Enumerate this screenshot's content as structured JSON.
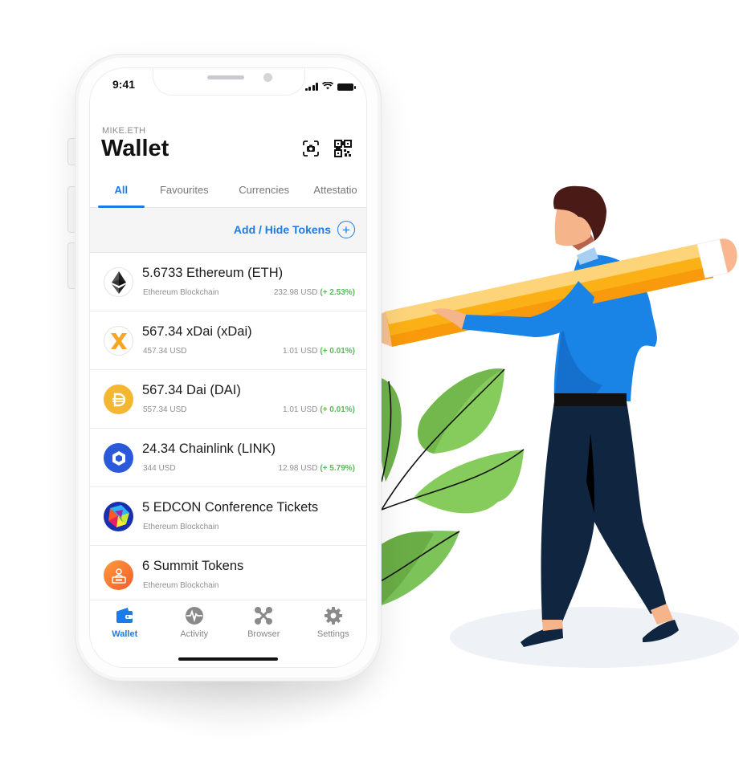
{
  "status_bar": {
    "time": "9:41"
  },
  "header": {
    "account": "MIKE.ETH",
    "title": "Wallet",
    "icons": [
      "camera-scan-icon",
      "qr-code-icon"
    ]
  },
  "tabs": [
    {
      "label": "All",
      "active": true
    },
    {
      "label": "Favourites",
      "active": false
    },
    {
      "label": "Currencies",
      "active": false
    },
    {
      "label": "Attestatio",
      "active": false
    }
  ],
  "add_hide_tokens": {
    "label": "Add / Hide Tokens",
    "icon": "plus-circle-icon"
  },
  "tokens": [
    {
      "name": "5.6733 Ethereum (ETH)",
      "subtitle": "Ethereum Blockchain",
      "price": "232.98 USD",
      "change": "(+ 2.53%)",
      "icon": "ethereum-icon"
    },
    {
      "name": "567.34 xDai (xDai)",
      "subtitle": "457.34 USD",
      "price": "1.01 USD",
      "change": "(+ 0.01%)",
      "icon": "xdai-icon"
    },
    {
      "name": "567.34 Dai (DAI)",
      "subtitle": "557.34 USD",
      "price": "1.01 USD",
      "change": "(+ 0.01%)",
      "icon": "dai-icon"
    },
    {
      "name": "24.34 Chainlink (LINK)",
      "subtitle": "344 USD",
      "price": "12.98 USD",
      "change": "(+ 5.79%)",
      "icon": "chainlink-icon"
    },
    {
      "name": "5 EDCON Conference Tickets",
      "subtitle": "Ethereum Blockchain",
      "price": "",
      "change": "",
      "icon": "edcon-icon"
    },
    {
      "name": "6 Summit Tokens",
      "subtitle": "Ethereum Blockchain",
      "price": "",
      "change": "",
      "icon": "summit-icon"
    }
  ],
  "bottom_nav": [
    {
      "label": "Wallet",
      "icon": "wallet-icon",
      "active": true
    },
    {
      "label": "Activity",
      "icon": "activity-icon",
      "active": false
    },
    {
      "label": "Browser",
      "icon": "browser-icon",
      "active": false
    },
    {
      "label": "Settings",
      "icon": "gear-icon",
      "active": false
    }
  ],
  "colors": {
    "accent": "#1d7be5",
    "positive_change": "#5cb85c",
    "shirt": "#1a84e6",
    "pants": "#0f2540",
    "pencil": "#fbb116",
    "leaf": "#7cc35a"
  }
}
